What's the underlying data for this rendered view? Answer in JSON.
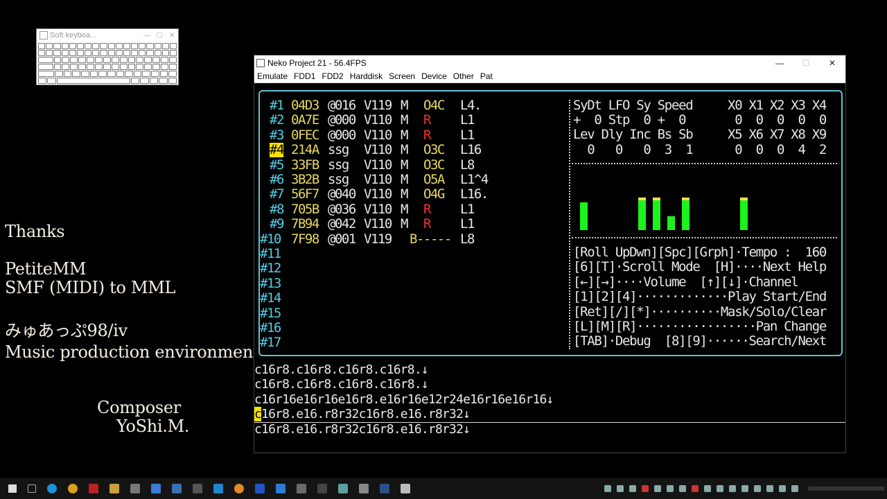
{
  "soft_keyboard": {
    "title": "Soft keyboa...",
    "controls": [
      "—",
      "☐",
      "✕"
    ]
  },
  "credits": {
    "thanks": "Thanks",
    "tool_name": "PetiteMM",
    "tool_desc": "SMF (MIDI) to MML",
    "env_name": "みゅあっぷ98/iv",
    "env_desc": "Music production environment",
    "composer_label": "Composer",
    "composer_name": "YoShi.M."
  },
  "emulator": {
    "title": "Neko Project 21 - 56.4FPS",
    "controls": [
      "—",
      "☐",
      "✕"
    ],
    "menu": [
      "Emulate",
      "FDD1",
      "FDD2",
      "Harddisk",
      "Screen",
      "Device",
      "Other",
      "Pat"
    ]
  },
  "tracks": [
    {
      "num": "#1",
      "addr": "04D3",
      "inst": "@016",
      "vol": "V119",
      "mode": "M",
      "note": "O4C",
      "note_color": "y",
      "len": "L4."
    },
    {
      "num": "#2",
      "addr": "0A7E",
      "inst": "@000",
      "vol": "V110",
      "mode": "M",
      "note": "R",
      "note_color": "r",
      "len": "L1"
    },
    {
      "num": "#3",
      "addr": "0FEC",
      "inst": "@000",
      "vol": "V110",
      "mode": "M",
      "note": "R",
      "note_color": "r",
      "len": "L1"
    },
    {
      "num": "#4",
      "addr": "214A",
      "inst": "ssg",
      "vol": "V110",
      "mode": "M",
      "note": "O3C",
      "note_color": "y",
      "len": "L16"
    },
    {
      "num": "#5",
      "addr": "33FB",
      "inst": "ssg",
      "vol": "V110",
      "mode": "M",
      "note": "O3C",
      "note_color": "y",
      "len": "L8"
    },
    {
      "num": "#6",
      "addr": "3B2B",
      "inst": "ssg",
      "vol": "V110",
      "mode": "M",
      "note": "O5A",
      "note_color": "y",
      "len": "L1^4"
    },
    {
      "num": "#7",
      "addr": "56F7",
      "inst": "@040",
      "vol": "V110",
      "mode": "M",
      "note": "O4G",
      "note_color": "y",
      "len": "L16."
    },
    {
      "num": "#8",
      "addr": "705B",
      "inst": "@036",
      "vol": "V110",
      "mode": "M",
      "note": "R",
      "note_color": "r",
      "len": "L1"
    },
    {
      "num": "#9",
      "addr": "7B94",
      "inst": "@042",
      "vol": "V110",
      "mode": "M",
      "note": "R",
      "note_color": "r",
      "len": "L1"
    },
    {
      "num": "#10",
      "addr": "7F98",
      "inst": "@001",
      "vol": "V119",
      "mode": "",
      "note": "B-----",
      "note_color": "y",
      "len": "L8"
    },
    {
      "num": "#11"
    },
    {
      "num": "#12"
    },
    {
      "num": "#13"
    },
    {
      "num": "#14"
    },
    {
      "num": "#15"
    },
    {
      "num": "#16"
    },
    {
      "num": "#17"
    }
  ],
  "status_panel": {
    "row1": "SyDt LFO Sy Speed     X0 X1 X2 X3 X4",
    "row2": "+  0 Stp  0 +  0       0  0  0  0  0",
    "row3": "Lev Dly Inc Bs Sb     X5 X6 X7 X8 X9",
    "row4": "  0   0   0  3  1      0  0  0  4  2"
  },
  "level_meter": {
    "levels": [
      0.62,
      0,
      0,
      0,
      0.72,
      0.72,
      0.3,
      0.72,
      0,
      0,
      0,
      0.72
    ],
    "caps": [
      false,
      false,
      false,
      false,
      true,
      true,
      false,
      true,
      false,
      false,
      false,
      true
    ]
  },
  "help": [
    "[Roll UpDwn][Spc][Grph]·Tempo :  160",
    "[6][T]·Scroll Mode  [H]····Next Help",
    "[←][→]····Volume  [↑][↓]·Channel",
    "[1][2][4]·············Play Start/End",
    "[Ret][/][*]··········Mask/Solo/Clear",
    "[L][M][R]·················Pan Change",
    "[TAB]·Debug  [8][9]······Search/Next"
  ],
  "mml_lines": [
    "c16r8.c16r8.c16r8.c16r8.↓",
    "c16r8.c16r8.c16r8.c16r8.↓",
    "c16r16e16r16e16r8.e16r16e12r24e16r16e16r16↓",
    "c16r8.e16.r8r32c16r8.e16.r8r32↓",
    "c16r8.e16.r8r32c16r8.e16.r8r32↓"
  ],
  "colors": {
    "accent_cyan": "#5ec4d0",
    "track_yellow": "#e8d860",
    "rest_red": "#ff3030",
    "meter_green": "#1cf21c"
  }
}
